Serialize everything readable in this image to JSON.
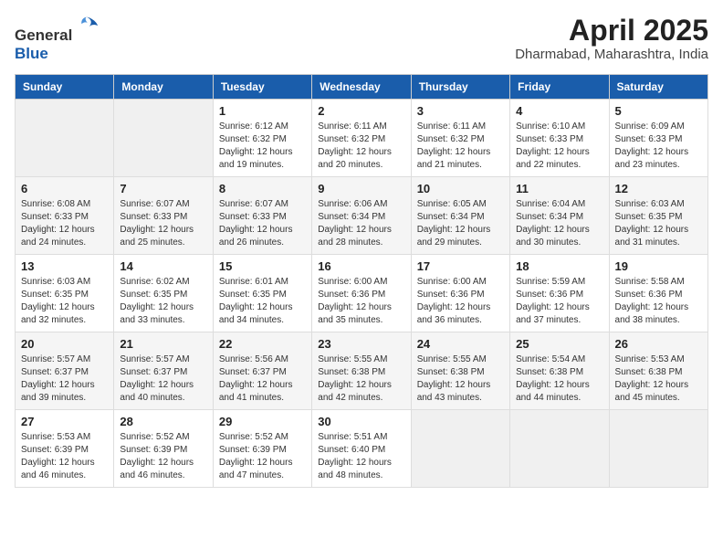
{
  "logo": {
    "general": "General",
    "blue": "Blue"
  },
  "title": {
    "month_year": "April 2025",
    "location": "Dharmabad, Maharashtra, India"
  },
  "days_of_week": [
    "Sunday",
    "Monday",
    "Tuesday",
    "Wednesday",
    "Thursday",
    "Friday",
    "Saturday"
  ],
  "weeks": [
    [
      {
        "day": "",
        "sunrise": "",
        "sunset": "",
        "daylight": ""
      },
      {
        "day": "",
        "sunrise": "",
        "sunset": "",
        "daylight": ""
      },
      {
        "day": "1",
        "sunrise": "Sunrise: 6:12 AM",
        "sunset": "Sunset: 6:32 PM",
        "daylight": "Daylight: 12 hours and 19 minutes."
      },
      {
        "day": "2",
        "sunrise": "Sunrise: 6:11 AM",
        "sunset": "Sunset: 6:32 PM",
        "daylight": "Daylight: 12 hours and 20 minutes."
      },
      {
        "day": "3",
        "sunrise": "Sunrise: 6:11 AM",
        "sunset": "Sunset: 6:32 PM",
        "daylight": "Daylight: 12 hours and 21 minutes."
      },
      {
        "day": "4",
        "sunrise": "Sunrise: 6:10 AM",
        "sunset": "Sunset: 6:33 PM",
        "daylight": "Daylight: 12 hours and 22 minutes."
      },
      {
        "day": "5",
        "sunrise": "Sunrise: 6:09 AM",
        "sunset": "Sunset: 6:33 PM",
        "daylight": "Daylight: 12 hours and 23 minutes."
      }
    ],
    [
      {
        "day": "6",
        "sunrise": "Sunrise: 6:08 AM",
        "sunset": "Sunset: 6:33 PM",
        "daylight": "Daylight: 12 hours and 24 minutes."
      },
      {
        "day": "7",
        "sunrise": "Sunrise: 6:07 AM",
        "sunset": "Sunset: 6:33 PM",
        "daylight": "Daylight: 12 hours and 25 minutes."
      },
      {
        "day": "8",
        "sunrise": "Sunrise: 6:07 AM",
        "sunset": "Sunset: 6:33 PM",
        "daylight": "Daylight: 12 hours and 26 minutes."
      },
      {
        "day": "9",
        "sunrise": "Sunrise: 6:06 AM",
        "sunset": "Sunset: 6:34 PM",
        "daylight": "Daylight: 12 hours and 28 minutes."
      },
      {
        "day": "10",
        "sunrise": "Sunrise: 6:05 AM",
        "sunset": "Sunset: 6:34 PM",
        "daylight": "Daylight: 12 hours and 29 minutes."
      },
      {
        "day": "11",
        "sunrise": "Sunrise: 6:04 AM",
        "sunset": "Sunset: 6:34 PM",
        "daylight": "Daylight: 12 hours and 30 minutes."
      },
      {
        "day": "12",
        "sunrise": "Sunrise: 6:03 AM",
        "sunset": "Sunset: 6:35 PM",
        "daylight": "Daylight: 12 hours and 31 minutes."
      }
    ],
    [
      {
        "day": "13",
        "sunrise": "Sunrise: 6:03 AM",
        "sunset": "Sunset: 6:35 PM",
        "daylight": "Daylight: 12 hours and 32 minutes."
      },
      {
        "day": "14",
        "sunrise": "Sunrise: 6:02 AM",
        "sunset": "Sunset: 6:35 PM",
        "daylight": "Daylight: 12 hours and 33 minutes."
      },
      {
        "day": "15",
        "sunrise": "Sunrise: 6:01 AM",
        "sunset": "Sunset: 6:35 PM",
        "daylight": "Daylight: 12 hours and 34 minutes."
      },
      {
        "day": "16",
        "sunrise": "Sunrise: 6:00 AM",
        "sunset": "Sunset: 6:36 PM",
        "daylight": "Daylight: 12 hours and 35 minutes."
      },
      {
        "day": "17",
        "sunrise": "Sunrise: 6:00 AM",
        "sunset": "Sunset: 6:36 PM",
        "daylight": "Daylight: 12 hours and 36 minutes."
      },
      {
        "day": "18",
        "sunrise": "Sunrise: 5:59 AM",
        "sunset": "Sunset: 6:36 PM",
        "daylight": "Daylight: 12 hours and 37 minutes."
      },
      {
        "day": "19",
        "sunrise": "Sunrise: 5:58 AM",
        "sunset": "Sunset: 6:36 PM",
        "daylight": "Daylight: 12 hours and 38 minutes."
      }
    ],
    [
      {
        "day": "20",
        "sunrise": "Sunrise: 5:57 AM",
        "sunset": "Sunset: 6:37 PM",
        "daylight": "Daylight: 12 hours and 39 minutes."
      },
      {
        "day": "21",
        "sunrise": "Sunrise: 5:57 AM",
        "sunset": "Sunset: 6:37 PM",
        "daylight": "Daylight: 12 hours and 40 minutes."
      },
      {
        "day": "22",
        "sunrise": "Sunrise: 5:56 AM",
        "sunset": "Sunset: 6:37 PM",
        "daylight": "Daylight: 12 hours and 41 minutes."
      },
      {
        "day": "23",
        "sunrise": "Sunrise: 5:55 AM",
        "sunset": "Sunset: 6:38 PM",
        "daylight": "Daylight: 12 hours and 42 minutes."
      },
      {
        "day": "24",
        "sunrise": "Sunrise: 5:55 AM",
        "sunset": "Sunset: 6:38 PM",
        "daylight": "Daylight: 12 hours and 43 minutes."
      },
      {
        "day": "25",
        "sunrise": "Sunrise: 5:54 AM",
        "sunset": "Sunset: 6:38 PM",
        "daylight": "Daylight: 12 hours and 44 minutes."
      },
      {
        "day": "26",
        "sunrise": "Sunrise: 5:53 AM",
        "sunset": "Sunset: 6:38 PM",
        "daylight": "Daylight: 12 hours and 45 minutes."
      }
    ],
    [
      {
        "day": "27",
        "sunrise": "Sunrise: 5:53 AM",
        "sunset": "Sunset: 6:39 PM",
        "daylight": "Daylight: 12 hours and 46 minutes."
      },
      {
        "day": "28",
        "sunrise": "Sunrise: 5:52 AM",
        "sunset": "Sunset: 6:39 PM",
        "daylight": "Daylight: 12 hours and 46 minutes."
      },
      {
        "day": "29",
        "sunrise": "Sunrise: 5:52 AM",
        "sunset": "Sunset: 6:39 PM",
        "daylight": "Daylight: 12 hours and 47 minutes."
      },
      {
        "day": "30",
        "sunrise": "Sunrise: 5:51 AM",
        "sunset": "Sunset: 6:40 PM",
        "daylight": "Daylight: 12 hours and 48 minutes."
      },
      {
        "day": "",
        "sunrise": "",
        "sunset": "",
        "daylight": ""
      },
      {
        "day": "",
        "sunrise": "",
        "sunset": "",
        "daylight": ""
      },
      {
        "day": "",
        "sunrise": "",
        "sunset": "",
        "daylight": ""
      }
    ]
  ]
}
